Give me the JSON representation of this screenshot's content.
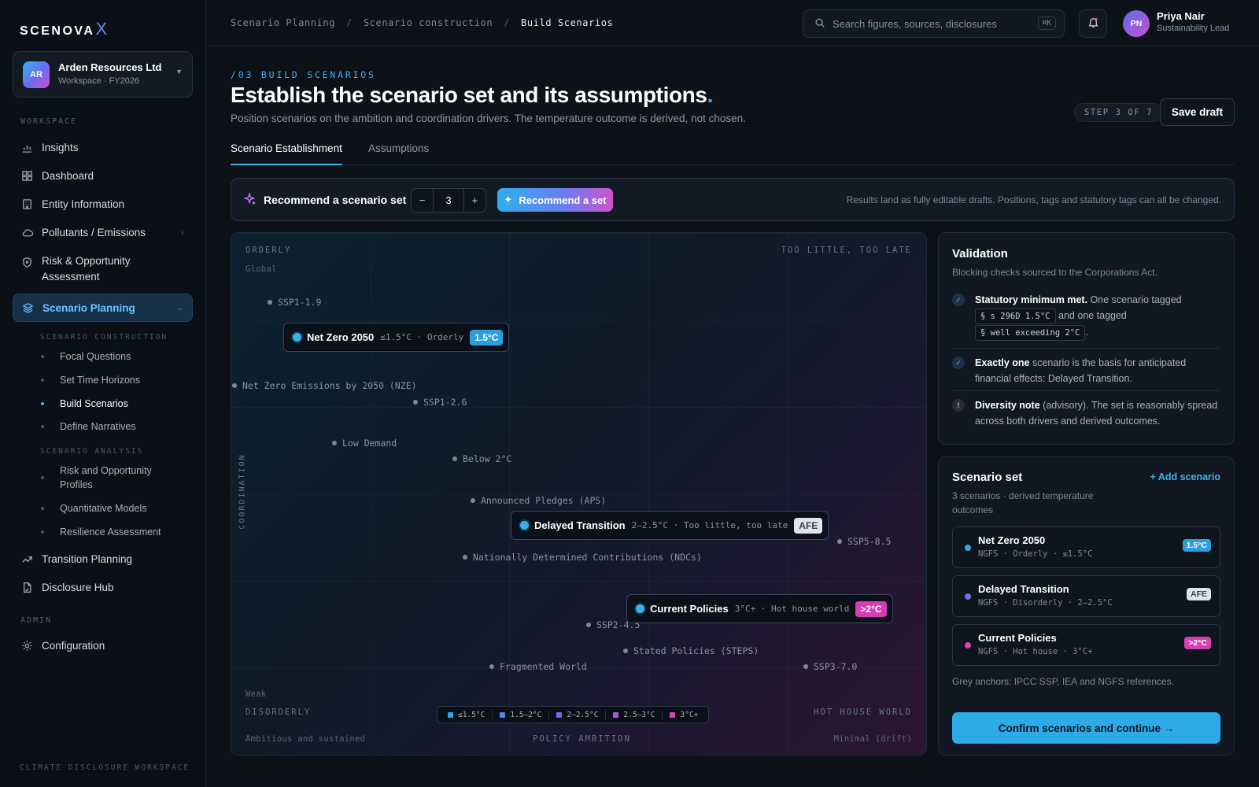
{
  "brand": {
    "name": "SCENOVA",
    "mark": "X"
  },
  "org": {
    "initials": "AR",
    "name": "Arden Resources Ltd",
    "sub": "Workspace · FY2026"
  },
  "sidebar": {
    "workspace_label": "WORKSPACE",
    "items": [
      {
        "label": "Insights",
        "icon": "bar-chart-icon"
      },
      {
        "label": "Dashboard",
        "icon": "grid-icon"
      },
      {
        "label": "Entity Information",
        "icon": "building-icon"
      },
      {
        "label": "Pollutants / Emissions",
        "icon": "cloud-icon"
      },
      {
        "label": "Risk & Opportunity Assessment",
        "icon": "shield-icon"
      },
      {
        "label": "Scenario Planning",
        "icon": "layers-icon"
      },
      {
        "label": "Transition Planning",
        "icon": "trend-icon"
      },
      {
        "label": "Disclosure Hub",
        "icon": "document-icon"
      }
    ],
    "construction_label": "SCENARIO CONSTRUCTION",
    "construction": [
      "Focal Questions",
      "Set Time Horizons",
      "Build Scenarios",
      "Define Narratives"
    ],
    "analysis_label": "SCENARIO ANALYSIS",
    "analysis": [
      "Risk and Opportunity Profiles",
      "Quantitative Models",
      "Resilience Assessment"
    ],
    "admin_label": "ADMIN",
    "admin": [
      {
        "label": "Configuration",
        "icon": "gear-icon"
      }
    ],
    "footer": "CLIMATE DISCLOSURE WORKSPACE"
  },
  "topbar": {
    "breadcrumb": [
      "Scenario Planning",
      "Scenario construction",
      "Build Scenarios"
    ],
    "search_placeholder": "Search figures, sources, disclosures",
    "search_kbd": "⌘K",
    "user": {
      "initials": "PN",
      "name": "Priya Nair",
      "role": "Sustainability Lead"
    }
  },
  "header": {
    "eyebrow": "/03 BUILD SCENARIOS",
    "title": "Establish the scenario set and its assumptions",
    "title_dot": ".",
    "lede": "Position scenarios on the ambition and coordination drivers. The temperature outcome is derived, not chosen.",
    "step": "STEP 3 OF 7",
    "save": "Save draft"
  },
  "tabs": [
    "Scenario Establishment",
    "Assumptions"
  ],
  "recommend": {
    "label": "Recommend a scenario set",
    "minus": "−",
    "value": "3",
    "plus": "+",
    "button": "Recommend a set",
    "note": "Results land as fully editable drafts. Positions, tags and statutory tags can all be changed."
  },
  "matrix": {
    "tl": "ORDERLY",
    "tl_sub": "Global",
    "tr": "TOO LITTLE, TOO LATE",
    "bl": "DISORDERLY",
    "bl_sub": "Weak",
    "br": "HOT HOUSE WORLD",
    "y_axis": "COORDINATION",
    "x_axis": "POLICY AMBITION",
    "x_left": "Ambitious and sustained",
    "x_right": "Minimal (drift)",
    "anchors": [
      "SSP1-1.9",
      "Net Zero Emissions by 2050 (NZE)",
      "SSP1-2.6",
      "Low Demand",
      "Below 2°C",
      "Announced Pledges (APS)",
      "SSP5-8.5",
      "Nationally Determined Contributions (NDCs)",
      "SSP2-4.5",
      "Stated Policies (STEPS)",
      "Fragmented World",
      "SSP3-7.0"
    ],
    "cards": [
      {
        "name": "Net Zero 2050",
        "meta": "≤1.5°C · Orderly",
        "badge": "1.5°C"
      },
      {
        "name": "Delayed Transition",
        "meta": "2–2.5°C · Too little, too late",
        "badge": "AFE"
      },
      {
        "name": "Current Policies",
        "meta": "3°C+ · Hot house world",
        "badge": ">2°C"
      }
    ],
    "legend": [
      {
        "label": "≤1.5°C",
        "color": "#2fa9e6"
      },
      {
        "label": "1.5–2°C",
        "color": "#4f86e6"
      },
      {
        "label": "2–2.5°C",
        "color": "#7a6ae8"
      },
      {
        "label": "2.5–3°C",
        "color": "#a658d8"
      },
      {
        "label": "3°C+",
        "color": "#d447b5"
      }
    ]
  },
  "validation": {
    "title": "Validation",
    "sub": "Blocking checks sourced to the Corporations Act.",
    "items": [
      {
        "bold": "Statutory minimum met.",
        "t1": " One scenario tagged ",
        "chip1": "§ s 296D 1.5°C",
        "t2": " and one tagged ",
        "chip2": "§ well exceeding 2°C",
        "t3": "."
      },
      {
        "bold": "Exactly one",
        "text": " scenario is the basis for anticipated financial effects: Delayed Transition."
      },
      {
        "bold": "Diversity note",
        "text": " (advisory). The set is reasonably spread across both drivers and derived outcomes."
      }
    ]
  },
  "scenario_set": {
    "title": "Scenario set",
    "add": "+ Add scenario",
    "sub": "3 scenarios · derived temperature outcomes",
    "items": [
      {
        "name": "Net Zero 2050",
        "meta": "NGFS · Orderly · ≤1.5°C",
        "badge": "1.5°C",
        "color": "#2fa9e6"
      },
      {
        "name": "Delayed Transition",
        "meta": "NGFS · Disorderly · 2–2.5°C",
        "badge": "AFE",
        "color": "#7a6ae8"
      },
      {
        "name": "Current Policies",
        "meta": "NGFS · Hot house · 3°C+",
        "badge": ">2°C",
        "color": "#d447b5"
      }
    ],
    "note": "Grey anchors: IPCC SSP, IEA and NGFS references.",
    "confirm": "Confirm scenarios and continue →"
  }
}
